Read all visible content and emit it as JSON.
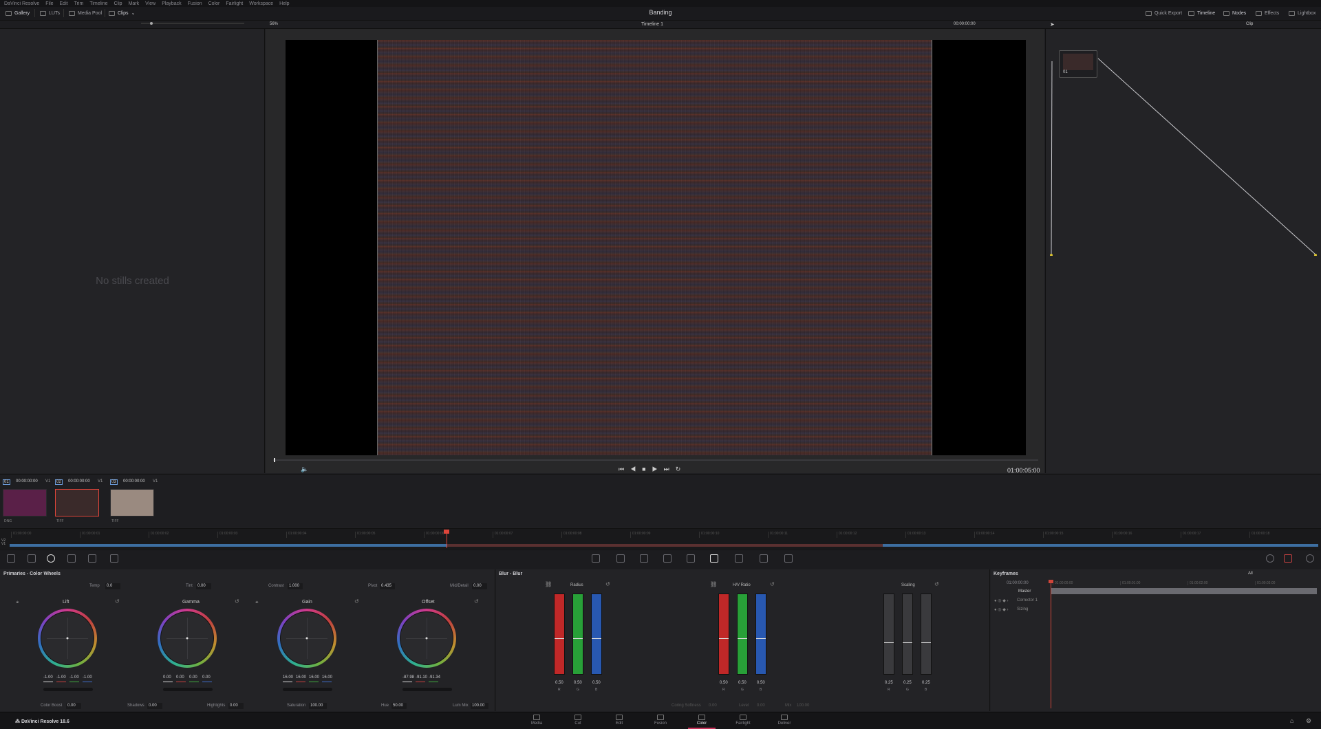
{
  "menu": [
    "DaVinci Resolve",
    "File",
    "Edit",
    "Trim",
    "Timeline",
    "Clip",
    "Mark",
    "View",
    "Playback",
    "Fusion",
    "Color",
    "Fairlight",
    "Workspace",
    "Help"
  ],
  "topbar": {
    "gallery": "Gallery",
    "luts": "LUTs",
    "media_pool": "Media Pool",
    "clips": "Clips",
    "project_title": "Banding",
    "quick_export": "Quick Export",
    "timeline": "Timeline",
    "nodes": "Nodes",
    "effects": "Effects",
    "lightbox": "Lightbox"
  },
  "viewer": {
    "zoom": "56%",
    "timeline_name": "Timeline 1",
    "top_timecode": "00:00:00:00",
    "bottom_timecode": "01:00:05:00",
    "clip_mode": "Clip"
  },
  "gallery": {
    "empty_message": "No stills created"
  },
  "node": {
    "label": "01"
  },
  "clips": [
    {
      "num": "01",
      "timecode": "00:00:00:00",
      "track": "V1",
      "format": "DNG",
      "color": "#5a2048"
    },
    {
      "num": "02",
      "timecode": "00:00:00:00",
      "track": "V1",
      "format": "TIFF",
      "color": "#3a2a2a"
    },
    {
      "num": "03",
      "timecode": "00:00:00:00",
      "track": "V1",
      "format": "TIFF",
      "color": "#9a8a80"
    }
  ],
  "mini_timeline": {
    "tracks": [
      "V2",
      "V1"
    ],
    "ticks": [
      "01:00:00:00",
      "01:00:00:01",
      "01:00:00:02",
      "01:00:00:03",
      "01:00:00:04",
      "01:00:00:05",
      "01:00:00:06",
      "01:00:00:07",
      "01:00:00:08",
      "01:00:00:09",
      "01:00:00:10",
      "01:00:00:11",
      "01:00:00:12",
      "01:00:00:13",
      "01:00:00:14",
      "01:00:00:15",
      "01:00:00:16",
      "01:00:00:17",
      "01:00:00:18"
    ]
  },
  "primaries": {
    "title": "Primaries - Color Wheels",
    "temp_label": "Temp",
    "temp": "0.0",
    "tint_label": "Tint",
    "tint": "0.00",
    "contrast_label": "Contrast",
    "contrast": "1.000",
    "pivot_label": "Pivot",
    "pivot": "0.435",
    "middetail_label": "Mid/Detail",
    "middetail": "0.00",
    "wheels": [
      {
        "name": "Lift",
        "values": [
          "-1.00",
          "-1.00",
          "-1.00",
          "-1.00"
        ]
      },
      {
        "name": "Gamma",
        "values": [
          "0.00",
          "0.00",
          "0.00",
          "0.00"
        ]
      },
      {
        "name": "Gain",
        "values": [
          "16.00",
          "16.00",
          "16.00",
          "16.00"
        ]
      },
      {
        "name": "Offset",
        "values": [
          "-87.98",
          "-91.10",
          "-91.34",
          ""
        ]
      }
    ],
    "colorboost_label": "Color Boost",
    "colorboost": "0.00",
    "shadows_label": "Shadows",
    "shadows": "0.00",
    "highlights_label": "Highlights",
    "highlights": "0.00",
    "saturation_label": "Saturation",
    "saturation": "100.00",
    "hue_label": "Hue",
    "hue": "50.00",
    "lummix_label": "Lum Mix",
    "lummix": "100.00"
  },
  "blur": {
    "title": "Blur - Blur",
    "radius_label": "Radius",
    "hv_label": "H/V Ratio",
    "scaling_label": "Scaling",
    "radius": [
      "0.50",
      "0.50",
      "0.50"
    ],
    "hv": [
      "0.50",
      "0.50",
      "0.50"
    ],
    "scaling": [
      "0.25",
      "0.25",
      "0.25"
    ],
    "channels": [
      "R",
      "G",
      "B"
    ],
    "coring_label": "Coring Softness",
    "coring": "0.00",
    "level_label": "Level",
    "level": "0.00",
    "mix_label": "Mix",
    "mix": "100.00"
  },
  "keyframes": {
    "title": "Keyframes",
    "filter": "All",
    "timecode": "01:00:00:00",
    "ticks": [
      "01:00:00:00",
      "01:00:01:00",
      "01:00:02:00",
      "01:00:03:00"
    ],
    "rows": [
      "Master",
      "Corrector 1",
      "Sizing"
    ]
  },
  "bottom": {
    "app": "DaVinci Resolve 18.6",
    "pages": [
      "Media",
      "Cut",
      "Edit",
      "Fusion",
      "Color",
      "Fairlight",
      "Deliver"
    ],
    "active_page": "Color"
  }
}
